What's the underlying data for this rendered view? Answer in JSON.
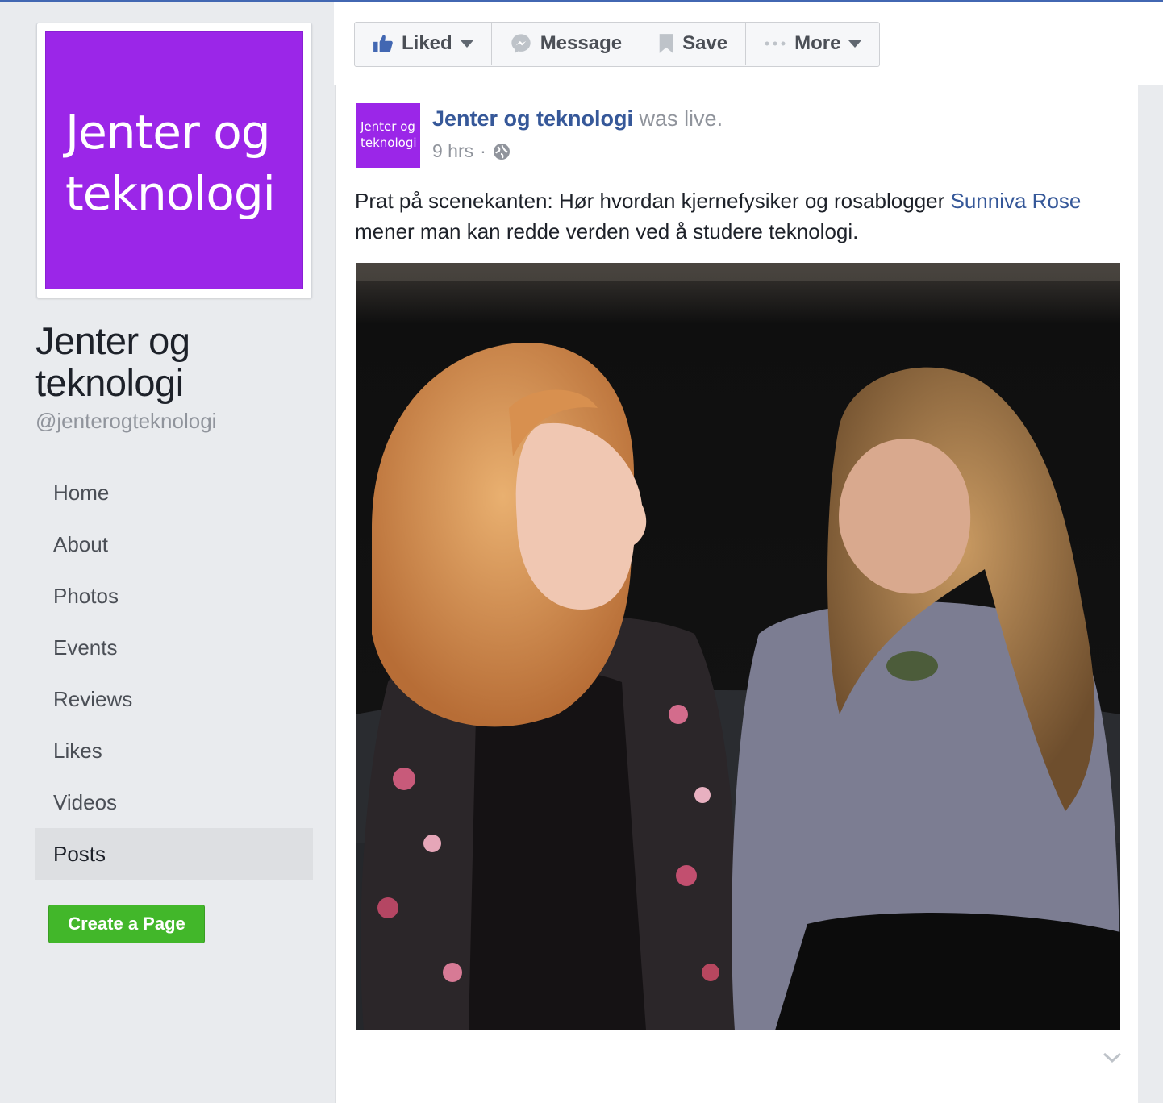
{
  "colors": {
    "brand_purple": "#9b26e8",
    "link_blue": "#365899",
    "create_green": "#42b72a"
  },
  "page": {
    "profile_pic_text": "Jenter og teknologi",
    "name": "Jenter og teknologi",
    "handle": "@jenterogteknologi"
  },
  "nav": {
    "items": [
      "Home",
      "About",
      "Photos",
      "Events",
      "Reviews",
      "Likes",
      "Videos",
      "Posts"
    ],
    "active": "Posts"
  },
  "create_page_label": "Create a Page",
  "actions": {
    "liked": {
      "label": "Liked",
      "icon": "thumbs-up-icon"
    },
    "message": {
      "label": "Message",
      "icon": "messenger-icon"
    },
    "save": {
      "label": "Save",
      "icon": "bookmark-icon"
    },
    "more": {
      "label": "More",
      "icon": "ellipsis-icon"
    }
  },
  "post": {
    "avatar_text": "Jenter og teknologi",
    "author": "Jenter og teknologi",
    "status": "was live.",
    "time": "9 hrs",
    "separator": "·",
    "privacy_icon": "globe-icon",
    "text_before": "Prat på scenekanten: Hør hvordan kjernefysiker og rosablogger ",
    "mention": "Sunniva Rose",
    "text_after": " mener man kan redde verden ved å studere teknologi."
  }
}
